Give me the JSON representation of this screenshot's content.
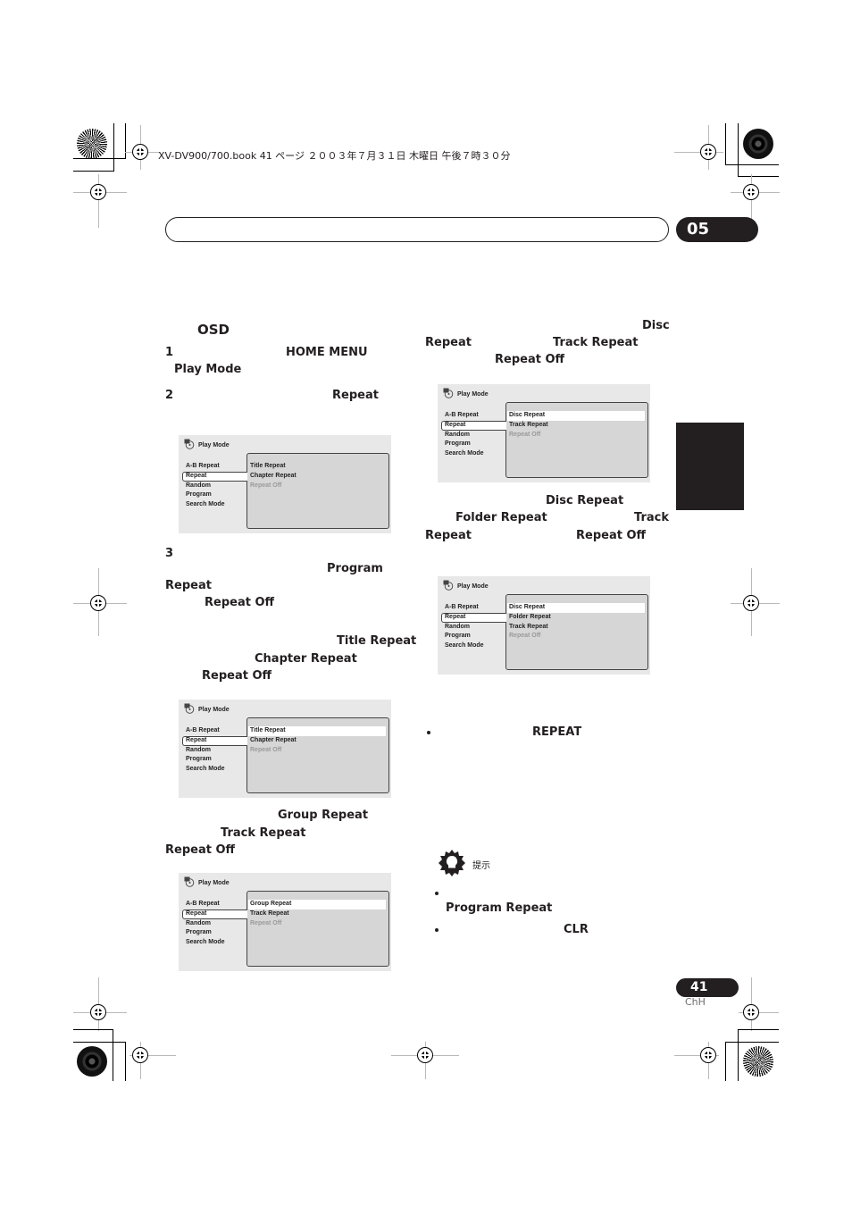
{
  "print_header": "XV-DV900/700.book  41 ページ  ２００３年７月３１日  木曜日  午後７時３０分",
  "chapter_number": "05",
  "left_column": {
    "osd_heading": "OSD",
    "step1": {
      "number": "1",
      "key1": "HOME MENU",
      "key2": "Play Mode"
    },
    "step2": {
      "number": "2",
      "key1": "Repeat"
    },
    "step3": {
      "number": "3",
      "key1": "Program",
      "key2": "Repeat",
      "key3": "Repeat Off"
    },
    "dvd_note": {
      "key1": "Title Repeat",
      "key2": "Chapter Repeat",
      "key3": "Repeat Off"
    },
    "group_note": {
      "key1": "Group Repeat",
      "key2": "Track Repeat",
      "key3": "Repeat Off"
    }
  },
  "right_column": {
    "cd_note": {
      "key1": "Disc",
      "key2": "Repeat",
      "key3": "Track Repeat",
      "key4": "Repeat Off"
    },
    "folder_note": {
      "key1": "Disc Repeat",
      "key2": "Folder Repeat",
      "key3": "Track",
      "key4": "Repeat",
      "key5": "Repeat Off"
    },
    "bullet1_key": "REPEAT",
    "hint_label": "提示",
    "hint_bullet1_key": "Program Repeat",
    "hint_bullet2_key": "CLR"
  },
  "osd_screens": [
    {
      "title": "Play Mode",
      "menu": [
        "A-B Repeat",
        "Repeat",
        "Random",
        "Program",
        "Search Mode"
      ],
      "selected_menu": "Repeat",
      "options": [
        {
          "label": "Title Repeat",
          "state": "normal"
        },
        {
          "label": "Chapter Repeat",
          "state": "normal"
        },
        {
          "label": "Repeat Off",
          "state": "disabled"
        }
      ]
    },
    {
      "title": "Play Mode",
      "menu": [
        "A-B Repeat",
        "Repeat",
        "Random",
        "Program",
        "Search Mode"
      ],
      "selected_menu": "Repeat",
      "options": [
        {
          "label": "Title Repeat",
          "state": "highlighted"
        },
        {
          "label": "Chapter Repeat",
          "state": "normal"
        },
        {
          "label": "Repeat Off",
          "state": "disabled"
        }
      ]
    },
    {
      "title": "Play Mode",
      "menu": [
        "A-B Repeat",
        "Repeat",
        "Random",
        "Program",
        "Search Mode"
      ],
      "selected_menu": "Repeat",
      "options": [
        {
          "label": "Group Repeat",
          "state": "highlighted"
        },
        {
          "label": "Track Repeat",
          "state": "normal"
        },
        {
          "label": "Repeat Off",
          "state": "disabled"
        }
      ]
    },
    {
      "title": "Play Mode",
      "menu": [
        "A-B Repeat",
        "Repeat",
        "Random",
        "Program",
        "Search Mode"
      ],
      "selected_menu": "Repeat",
      "options": [
        {
          "label": "Disc Repeat",
          "state": "highlighted"
        },
        {
          "label": "Track Repeat",
          "state": "normal"
        },
        {
          "label": "Repeat Off",
          "state": "disabled"
        }
      ]
    },
    {
      "title": "Play Mode",
      "menu": [
        "A-B Repeat",
        "Repeat",
        "Random",
        "Program",
        "Search Mode"
      ],
      "selected_menu": "Repeat",
      "options": [
        {
          "label": "Disc Repeat",
          "state": "highlighted"
        },
        {
          "label": "Folder Repeat",
          "state": "normal"
        },
        {
          "label": "Track Repeat",
          "state": "normal"
        },
        {
          "label": "Repeat Off",
          "state": "disabled"
        }
      ]
    }
  ],
  "page_number": "41",
  "language_code": "ChH"
}
